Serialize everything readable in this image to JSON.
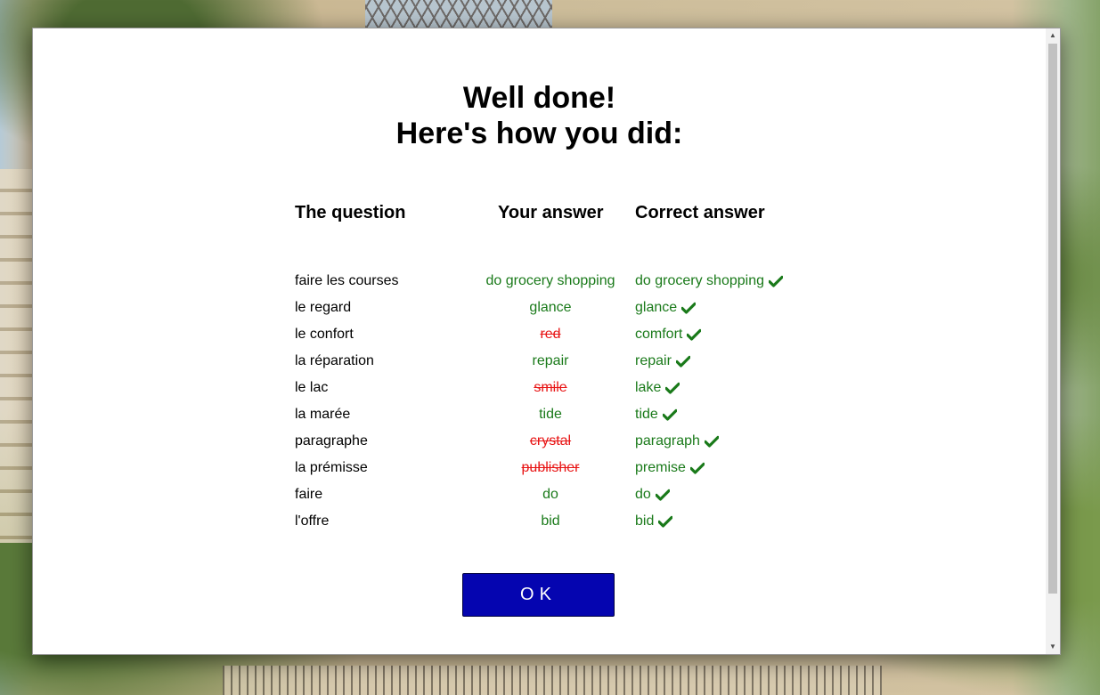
{
  "dialog": {
    "title_line1": "Well done!",
    "title_line2": "Here's how you did:",
    "headers": {
      "question": "The question",
      "your_answer": "Your answer",
      "correct_answer": "Correct answer"
    },
    "rows": [
      {
        "question": "faire les courses",
        "your_answer": "do grocery shopping",
        "correct_answer": "do grocery shopping",
        "is_correct": true
      },
      {
        "question": "le regard",
        "your_answer": "glance",
        "correct_answer": "glance",
        "is_correct": true
      },
      {
        "question": "le confort",
        "your_answer": "red",
        "correct_answer": "comfort",
        "is_correct": false
      },
      {
        "question": "la réparation",
        "your_answer": "repair",
        "correct_answer": "repair",
        "is_correct": true
      },
      {
        "question": "le lac",
        "your_answer": "smile",
        "correct_answer": "lake",
        "is_correct": false
      },
      {
        "question": "la marée",
        "your_answer": "tide",
        "correct_answer": "tide",
        "is_correct": true
      },
      {
        "question": "paragraphe",
        "your_answer": "crystal",
        "correct_answer": "paragraph",
        "is_correct": false
      },
      {
        "question": "la prémisse",
        "your_answer": "publisher",
        "correct_answer": "premise",
        "is_correct": false
      },
      {
        "question": "faire",
        "your_answer": "do",
        "correct_answer": "do",
        "is_correct": true
      },
      {
        "question": "l'offre",
        "your_answer": "bid",
        "correct_answer": "bid",
        "is_correct": true
      }
    ],
    "ok_label": "OK",
    "icons": {
      "correct_mark": "check-icon"
    }
  },
  "colors": {
    "correct_text": "#1a7a1a",
    "wrong_text": "#e81515",
    "button_bg": "#0505b0",
    "button_text": "#ffffff"
  }
}
